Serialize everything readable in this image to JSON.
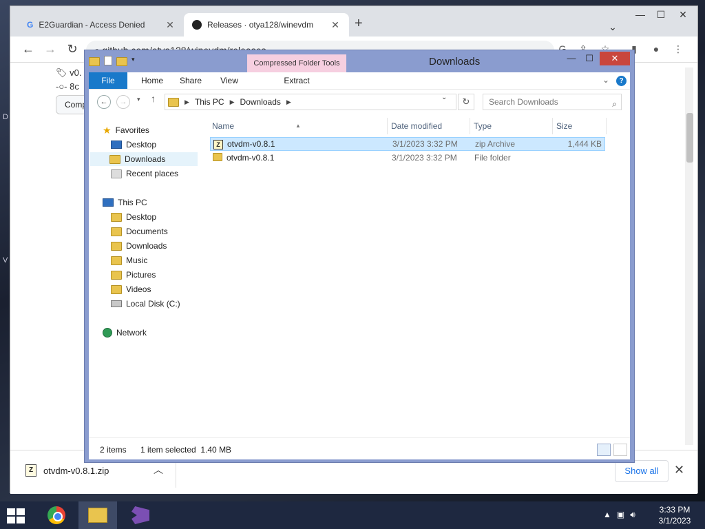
{
  "chrome": {
    "tabs": [
      {
        "title": "E2Guardian - Access Denied",
        "favicon": "G"
      },
      {
        "title": "Releases · otya128/winevdm",
        "favicon": "github-icon"
      }
    ],
    "newtab_label": "+",
    "url": "github.com/otya128/winevdm/releases",
    "page": {
      "tag_text": "v0.",
      "commit_text": "8c",
      "compare_button": "Comp"
    }
  },
  "download_bar": {
    "file_name": "otvdm-v0.8.1.zip",
    "show_all": "Show all"
  },
  "explorer": {
    "title": "Downloads",
    "context_tab": "Compressed Folder Tools",
    "ribbon_tabs": [
      "File",
      "Home",
      "Share",
      "View"
    ],
    "context_subtab": "Extract",
    "address": [
      "This PC",
      "Downloads"
    ],
    "search_placeholder": "Search Downloads",
    "nav": {
      "favorites": "Favorites",
      "fav_items": [
        "Desktop",
        "Downloads",
        "Recent places"
      ],
      "this_pc": "This PC",
      "pc_items": [
        "Desktop",
        "Documents",
        "Downloads",
        "Music",
        "Pictures",
        "Videos",
        "Local Disk (C:)"
      ],
      "network": "Network"
    },
    "columns": [
      "Name",
      "Date modified",
      "Type",
      "Size"
    ],
    "files": [
      {
        "name": "otvdm-v0.8.1",
        "date": "3/1/2023 3:32 PM",
        "type": "zip Archive",
        "size": "1,444 KB",
        "icon": "zip-icon"
      },
      {
        "name": "otvdm-v0.8.1",
        "date": "3/1/2023 3:32 PM",
        "type": "File folder",
        "size": "",
        "icon": "folder-icon"
      }
    ],
    "status": {
      "count": "2 items",
      "selection": "1 item selected  1.40 MB"
    }
  },
  "taskbar": {
    "time": "3:33 PM",
    "date": "3/1/2023"
  }
}
